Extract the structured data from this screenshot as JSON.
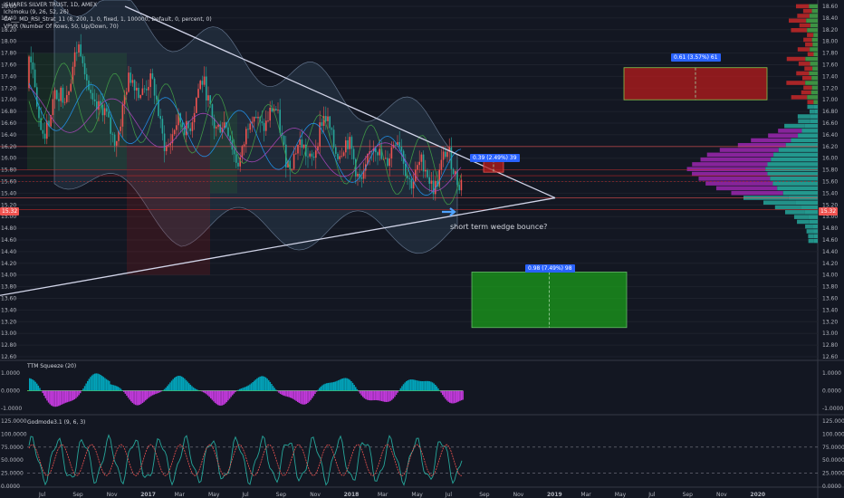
{
  "legend": {
    "lines": [
      "ISHARES SILVER TRUST, 1D, AMEX",
      "Ichimoku (9, 26, 52, 26)",
      "CA___MD_RSI_Strat_11 (8, 200, 1, 0, fixed, 1, 100000, Default, 0, percent, 0)",
      "VPVR (Number Of Rows, 50, Up/Down, 70)"
    ]
  },
  "annotation": {
    "text": "short term wedge bounce?"
  },
  "colors": {
    "background": "#131722",
    "up": "#ef5350",
    "down": "#26a69a",
    "wedge": "#d1d4e8",
    "loss_box": "#b71c1c",
    "profit_box": "#1b9e1b",
    "badge": "#2962ff",
    "vp_purple": "#9c27b0",
    "vp_teal": "#26a69a",
    "vp_red": "#c62828",
    "vp_green": "#43a047"
  },
  "chart_data": [
    {
      "type": "candlestick",
      "title": "ISHARES SILVER TRUST, 1D, AMEX",
      "x_ticks": [
        "Jul",
        "Sep",
        "Nov",
        "2017",
        "Mar",
        "May",
        "Jul",
        "Sep",
        "Nov",
        "2018",
        "Mar",
        "May",
        "Jul",
        "Sep",
        "Nov",
        "2019",
        "Mar",
        "May",
        "Jul",
        "Sep",
        "Nov",
        "2020"
      ],
      "y_ticks": [
        "18.60",
        "18.40",
        "18.20",
        "18.00",
        "17.80",
        "17.60",
        "17.40",
        "17.20",
        "17.00",
        "16.80",
        "16.60",
        "16.40",
        "16.20",
        "16.00",
        "15.80",
        "15.60",
        "15.40",
        "15.20",
        "15.00",
        "14.80",
        "14.60",
        "14.40",
        "14.20",
        "14.00",
        "13.80",
        "13.60",
        "13.40",
        "13.20",
        "13.00",
        "12.80",
        "12.60"
      ],
      "ylim": [
        12.5,
        18.7
      ],
      "last_price": "15.32",
      "wedge": {
        "upper_start": {
          "date": "2016-07",
          "value": 18.6
        },
        "lower_start": {
          "date": "2016-05",
          "value": 13.65
        },
        "apex": {
          "date": "2018-11",
          "value": 15.32
        }
      },
      "positions": [
        {
          "kind": "short",
          "label": "0.39 (2.49%) 39",
          "entry": 15.76,
          "stop": 16.05
        },
        {
          "kind": "long",
          "label": "0.61 (3.57%) 61",
          "entry": 17.55,
          "stop": 17.0
        },
        {
          "kind": "long",
          "label": "0.98 (7.49%) 98",
          "entry": 14.05,
          "stop": 13.1
        }
      ],
      "horizontal_levels": [
        16.2,
        15.8,
        15.7,
        15.6,
        15.32,
        15.12
      ]
    },
    {
      "type": "histogram",
      "title": "TTM Squeeze (20)",
      "y_ticks": [
        "1.0000",
        "0.0000",
        "-1.0000"
      ],
      "ylim": [
        -1.2,
        1.3
      ]
    },
    {
      "type": "line",
      "title": "Godmode3.1 (9, 6, 3)",
      "y_ticks": [
        "125.0000",
        "100.0000",
        "75.0000",
        "50.0000",
        "25.0000",
        "0.0000"
      ],
      "ylim": [
        0,
        125
      ]
    }
  ]
}
